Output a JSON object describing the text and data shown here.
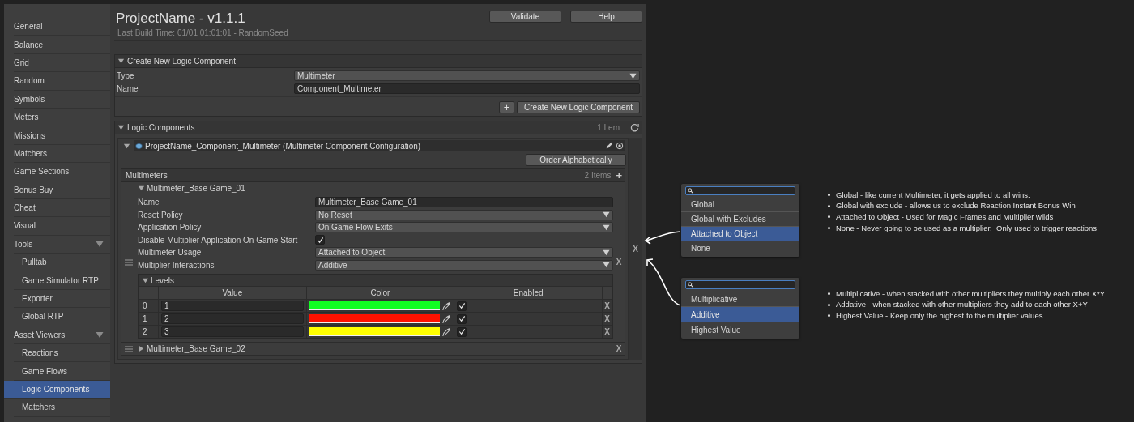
{
  "sidebar": {
    "items": [
      {
        "label": "General",
        "selected": false
      },
      {
        "label": "Balance",
        "selected": false
      },
      {
        "label": "Grid",
        "selected": false
      },
      {
        "label": "Random",
        "selected": false
      },
      {
        "label": "Symbols",
        "selected": false
      },
      {
        "label": "Meters",
        "selected": false
      },
      {
        "label": "Missions",
        "selected": false
      },
      {
        "label": "Matchers",
        "selected": false
      },
      {
        "label": "Game Sections",
        "selected": false
      },
      {
        "label": "Bonus Buy",
        "selected": false
      },
      {
        "label": "Cheat",
        "selected": false
      },
      {
        "label": "Visual",
        "selected": false
      },
      {
        "label": "Tools",
        "selected": false,
        "expanded": true,
        "children": [
          {
            "label": "Pulltab",
            "selected": false
          },
          {
            "label": "Game Simulator RTP",
            "selected": false
          },
          {
            "label": "Exporter",
            "selected": false
          },
          {
            "label": "Global RTP",
            "selected": false
          }
        ]
      },
      {
        "label": "Asset Viewers",
        "selected": false,
        "expanded": true,
        "children": [
          {
            "label": "Reactions",
            "selected": false
          },
          {
            "label": "Game Flows",
            "selected": false
          },
          {
            "label": "Logic Components",
            "selected": true
          },
          {
            "label": "Matchers",
            "selected": false
          }
        ]
      }
    ]
  },
  "header": {
    "title": "ProjectName - v1.1.1",
    "subtitle": "Last Build Time: 01/01 01:01:01 - RandomSeed",
    "buttons": [
      "Validate",
      "Help"
    ]
  },
  "create_panel": {
    "title": "Create New Logic Component",
    "expanded": true,
    "fields": [
      {
        "label": "Type",
        "kind": "dropdown",
        "value": "Multimeter"
      },
      {
        "label": "Name",
        "kind": "text",
        "value": "Component_Multimeter"
      }
    ],
    "add_icon": "+",
    "button": "Create New Logic Component"
  },
  "logic_components": {
    "title": "Logic Components",
    "expanded": true,
    "count": "1 Item",
    "remove": "X",
    "component": {
      "title": "ProjectName_Component_Multimeter (Multimeter Component Configuration)",
      "expanded": true,
      "order_button": "Order Alphabetically",
      "list": {
        "title": "Multimeters",
        "count": "2 Items",
        "add": "+",
        "items": [
          {
            "title": "Multimeter_Base Game_01",
            "expanded": true,
            "remove": "X",
            "fields": [
              {
                "label": "Name",
                "kind": "text",
                "value": "Multimeter_Base Game_01"
              },
              {
                "label": "Reset Policy",
                "kind": "dropdown",
                "value": "No Reset"
              },
              {
                "label": "Application Policy",
                "kind": "dropdown",
                "value": "On Game Flow Exits"
              },
              {
                "label": "Disable Multiplier Application On Game Start",
                "kind": "checkbox",
                "checked": true
              },
              {
                "label": "Multimeter Usage",
                "kind": "dropdown",
                "value": "Attached to Object"
              },
              {
                "label": "Multiplier Interactions",
                "kind": "dropdown",
                "value": "Additive"
              }
            ],
            "levels": {
              "title": "Levels",
              "expanded": true,
              "columns": [
                "Value",
                "Color",
                "Enabled"
              ],
              "rows": [
                {
                  "index": "0",
                  "value": "1",
                  "color": "#11ff22",
                  "enabled": true,
                  "remove": "X"
                },
                {
                  "index": "1",
                  "value": "2",
                  "color": "#ff1100",
                  "enabled": true,
                  "remove": "X"
                },
                {
                  "index": "2",
                  "value": "3",
                  "color": "#ffff00",
                  "enabled": true,
                  "remove": "X"
                }
              ]
            }
          },
          {
            "title": "Multimeter_Base Game_02",
            "expanded": false,
            "remove": "X"
          }
        ]
      }
    }
  },
  "popups": [
    {
      "options": [
        {
          "label": "Global",
          "selected": false
        },
        {
          "label": "Global with Excludes",
          "selected": false
        },
        {
          "label": "Attached to Object",
          "selected": true
        },
        {
          "label": "None",
          "selected": false
        }
      ]
    },
    {
      "options": [
        {
          "label": "Multiplicative",
          "selected": false
        },
        {
          "label": "Additive",
          "selected": true
        },
        {
          "label": "Highest Value",
          "selected": false
        }
      ]
    }
  ],
  "notes": [
    [
      "Global - like current Multimeter, it gets applied to all wins.",
      "Global with exclude - allows us to exclude Reaction Instant Bonus Win",
      "Attached to Object - Used for Magic Frames and Multiplier wilds",
      "None - Never going to be used as a multiplier.  Only used to trigger reactions"
    ],
    [
      "Multiplicative - when stacked with other multipliers they multiply each other X*Y",
      "Addative - when stacked with other multipliers they add to each other X+Y",
      "Highest Value - Keep only the highest fo the multiplier values"
    ]
  ]
}
